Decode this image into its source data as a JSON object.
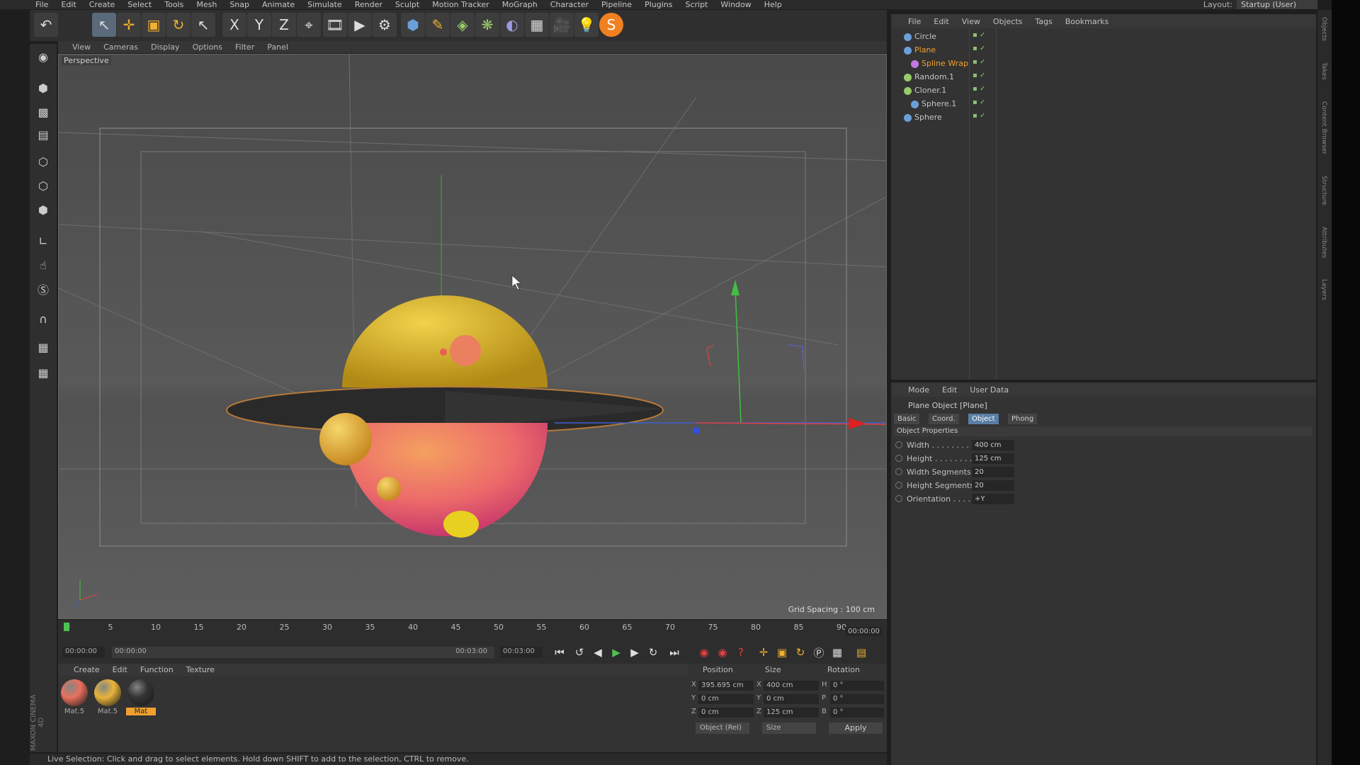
{
  "menubar": [
    "File",
    "Edit",
    "Create",
    "Select",
    "Tools",
    "Mesh",
    "Snap",
    "Animate",
    "Simulate",
    "Render",
    "Sculpt",
    "Motion Tracker",
    "MoGraph",
    "Character",
    "Pipeline",
    "Plugins",
    "Script",
    "Window",
    "Help"
  ],
  "layout": {
    "label": "Layout:",
    "value": "Startup (User)"
  },
  "toolbar": {
    "undo": "↶",
    "live_select": "↖",
    "move": "✛",
    "scale": "▣",
    "rotate": "↻",
    "recent": "↖",
    "x": "X",
    "y": "Y",
    "z": "Z",
    "coord": "⌖",
    "render_view": "🎞",
    "render_pv": "▶",
    "render_settings": "⚙",
    "cube": "⬢",
    "pen": "✎",
    "subdiv": "◈",
    "array": "❋",
    "deformer": "◐",
    "floor": "▦",
    "camera": "🎥",
    "light": "💡",
    "s_plugin": "S"
  },
  "viewport": {
    "menu": [
      "View",
      "Cameras",
      "Display",
      "Options",
      "Filter",
      "Panel"
    ],
    "label": "Perspective",
    "grid_spacing": "Grid Spacing : 100 cm"
  },
  "timeline": {
    "ticks": [
      "0",
      "5",
      "10",
      "15",
      "20",
      "25",
      "30",
      "35",
      "40",
      "45",
      "50",
      "55",
      "60",
      "65",
      "70",
      "75",
      "80",
      "85",
      "90"
    ],
    "current": "00:00:00",
    "start": "00:00:00",
    "range_start": "00:00:00",
    "range_end": "00:03:00",
    "end": "00:03:00"
  },
  "materials": {
    "menu": [
      "Create",
      "Edit",
      "Function",
      "Texture"
    ],
    "items": [
      {
        "name": "Mat.5",
        "color": "#e9705d"
      },
      {
        "name": "Mat.5",
        "color": "#e9b43a"
      },
      {
        "name": "Mat",
        "color": "#333333"
      }
    ]
  },
  "coords": {
    "headers": [
      "Position",
      "Size",
      "Rotation"
    ],
    "rows": [
      {
        "axis": "X",
        "pos": "395.695 cm",
        "saxis": "X",
        "size": "400 cm",
        "raxis": "H",
        "rot": "0 °"
      },
      {
        "axis": "Y",
        "pos": "0 cm",
        "saxis": "Y",
        "size": "0 cm",
        "raxis": "P",
        "rot": "0 °"
      },
      {
        "axis": "Z",
        "pos": "0 cm",
        "saxis": "Z",
        "size": "125 cm",
        "raxis": "B",
        "rot": "0 °"
      }
    ],
    "mode": "Object (Rel)",
    "size_mode": "Size",
    "apply": "Apply"
  },
  "status": "Live Selection: Click and drag to select elements. Hold down SHIFT to add to the selection, CTRL to remove.",
  "maxon": "MAXON CINEMA 4D",
  "objects": {
    "menu": [
      "File",
      "Edit",
      "View",
      "Objects",
      "Tags",
      "Bookmarks"
    ],
    "items": [
      {
        "name": "Circle",
        "indent": 0,
        "color": "#6aa0d8",
        "highlight": false
      },
      {
        "name": "Plane",
        "indent": 0,
        "color": "#6aa0d8",
        "highlight": true
      },
      {
        "name": "Spline Wrap",
        "indent": 1,
        "color": "#c07adf",
        "highlight": true
      },
      {
        "name": "Random.1",
        "indent": 0,
        "color": "#9acb6b",
        "highlight": false
      },
      {
        "name": "Cloner.1",
        "indent": 0,
        "color": "#9acb6b",
        "highlight": false
      },
      {
        "name": "Sphere.1",
        "indent": 1,
        "color": "#6aa0d8",
        "highlight": false
      },
      {
        "name": "Sphere",
        "indent": 0,
        "color": "#6aa0d8",
        "highlight": false
      }
    ]
  },
  "attributes": {
    "menu": [
      "Mode",
      "Edit",
      "User Data"
    ],
    "title": "Plane Object [Plane]",
    "tabs": [
      "Basic",
      "Coord.",
      "Object",
      "Phong"
    ],
    "active_tab": "Object",
    "section": "Object Properties",
    "props": [
      {
        "label": "Width . . . . . . . . .",
        "value": "400 cm"
      },
      {
        "label": "Height . . . . . . . .",
        "value": "125 cm"
      },
      {
        "label": "Width Segments",
        "value": "20"
      },
      {
        "label": "Height Segments",
        "value": "20"
      },
      {
        "label": "Orientation . . . .",
        "value": "+Y"
      }
    ]
  },
  "right_strip": [
    "Objects",
    "Takes",
    "Content Browser",
    "Structure",
    "Attributes",
    "Layers"
  ],
  "colors": {
    "accent": "#5a7ea6",
    "highlight_text": "#f0a030"
  }
}
